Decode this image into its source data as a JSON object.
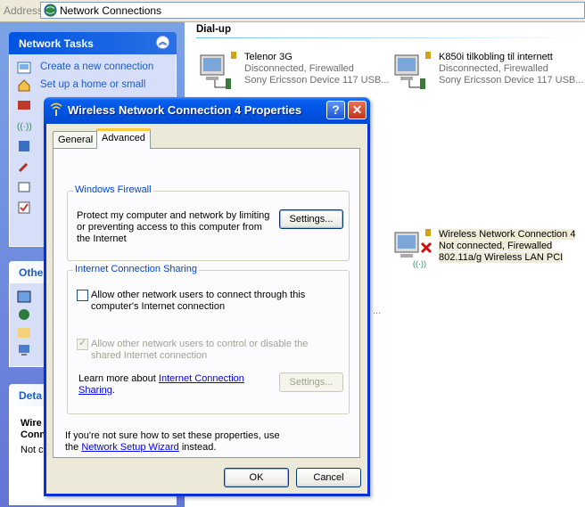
{
  "address_bar": {
    "label": "Address",
    "value": "Network Connections"
  },
  "task_pane": {
    "network_tasks": {
      "title": "Network Tasks",
      "items": [
        {
          "label": "Create a new connection",
          "icon": "new-connection-icon"
        },
        {
          "label": "Set up a home or small",
          "icon": "home-network-icon"
        }
      ]
    },
    "other_places": {
      "title": "Othe"
    },
    "details": {
      "title": "Deta",
      "name_line1": "Wire",
      "name_line2": "Conn",
      "status": "Not c"
    }
  },
  "content": {
    "group_title": "Dial-up",
    "connections": [
      {
        "name": "Telenor 3G",
        "status": "Disconnected, Firewalled",
        "device": "Sony Ericsson Device 117 USB..."
      },
      {
        "name": "K850i tilkobling til internett",
        "status": "Disconnected, Firewalled",
        "device": "Sony Ericsson Device 117 USB..."
      },
      {
        "name": "Wireless Network Connection 4",
        "status": "Not connected, Firewalled",
        "device": "802.11a/g Wireless LAN PCI"
      }
    ],
    "ellipsis": "..."
  },
  "dialog": {
    "title": "Wireless Network Connection 4 Properties",
    "help_button": "?",
    "close_button": "✕",
    "tabs": [
      "General",
      "Advanced"
    ],
    "active_tab": "Advanced",
    "firewall": {
      "title": "Windows Firewall",
      "text_line1": "Protect my computer and network by limiting",
      "text_line2": "or preventing access to this computer from",
      "text_line3": "the Internet",
      "settings_button": "Settings..."
    },
    "ics": {
      "title": "Internet Connection Sharing",
      "allow_connect_line1": "Allow other network users to connect through this",
      "allow_connect_line2": "computer's Internet connection",
      "allow_connect_checked": false,
      "allow_control_line1": "Allow other network users to control or disable the",
      "allow_control_line2": "shared Internet connection",
      "allow_control_checked": true,
      "learn_more_prefix": "Learn more about ",
      "learn_more_link1": "Internet Connection",
      "learn_more_link2": "Sharing",
      "learn_more_suffix": ".",
      "settings_button": "Settings..."
    },
    "footer_line1": "If you're not sure how to set these properties, use",
    "footer_prefix": "the ",
    "footer_link": "Network Setup Wizard",
    "footer_suffix": " instead.",
    "ok_button": "OK",
    "cancel_button": "Cancel"
  },
  "colors": {
    "xp_blue": "#0054e3",
    "link": "#215dc6",
    "dialog_face": "#ece9d8",
    "group_title": "#0046d5"
  }
}
